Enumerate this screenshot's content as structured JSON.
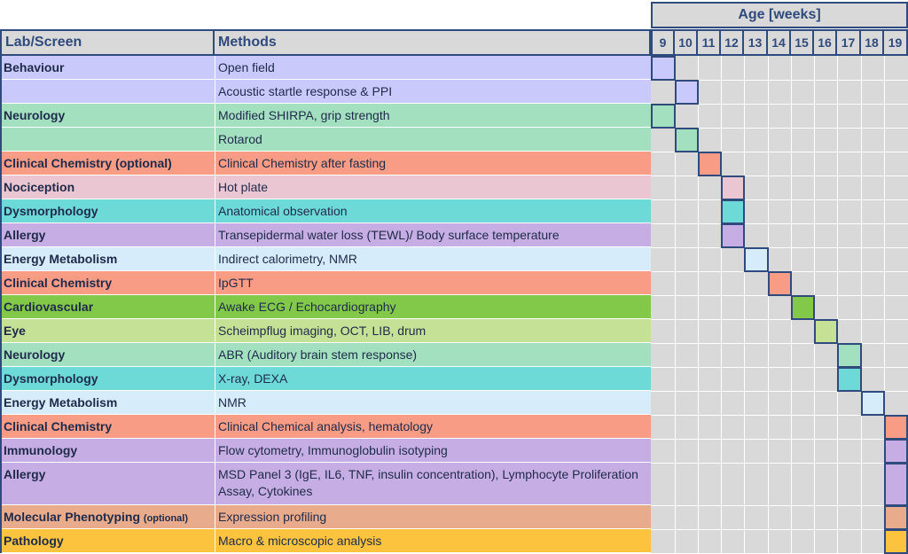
{
  "header": {
    "age_label": "Age [weeks]",
    "lab_label": "Lab/Screen",
    "methods_label": "Methods",
    "weeks": [
      "9",
      "10",
      "11",
      "12",
      "13",
      "14",
      "15",
      "16",
      "17",
      "18",
      "19"
    ]
  },
  "rows": [
    {
      "lab": "Behaviour",
      "method": "Open field",
      "color": "#c9c9fb",
      "week": "9"
    },
    {
      "lab": "",
      "method": "Acoustic startle response & PPI",
      "color": "#c9c9fb",
      "week": "10"
    },
    {
      "lab": "Neurology",
      "method": "Modified SHIRPA, grip strength",
      "color": "#a3e0c0",
      "week": "9"
    },
    {
      "lab": "",
      "method": "Rotarod",
      "color": "#a3e0c0",
      "week": "10"
    },
    {
      "lab": "Clinical Chemistry (optional)",
      "method": "Clinical Chemistry after fasting",
      "color": "#f89c85",
      "week": "11"
    },
    {
      "lab": "Nociception",
      "method": "Hot plate",
      "color": "#eac6d2",
      "week": "12"
    },
    {
      "lab": "Dysmorphology",
      "method": "Anatomical observation",
      "color": "#6ddad8",
      "week": "12"
    },
    {
      "lab": "Allergy",
      "method": "Transepidermal water loss (TEWL)/ Body surface temperature",
      "color": "#c6aee4",
      "week": "12"
    },
    {
      "lab": "Energy Metabolism",
      "method": "Indirect calorimetry, NMR",
      "color": "#d6ecfa",
      "week": "13"
    },
    {
      "lab": "Clinical Chemistry",
      "method": "IpGTT",
      "color": "#f89c85",
      "week": "14"
    },
    {
      "lab": "Cardiovascular",
      "method": "Awake ECG / Echocardiography",
      "color": "#82c94a",
      "week": "15"
    },
    {
      "lab": "Eye",
      "method": "Scheimpflug imaging, OCT, LIB, drum",
      "color": "#c5e196",
      "week": "16"
    },
    {
      "lab": "Neurology",
      "method": "ABR (Auditory brain stem response)",
      "color": "#a3e0c0",
      "week": "17"
    },
    {
      "lab": "Dysmorphology",
      "method": "X-ray, DEXA",
      "color": "#6ddad8",
      "week": "17"
    },
    {
      "lab": "Energy Metabolism",
      "method": "NMR",
      "color": "#d6ecfa",
      "week": "18"
    },
    {
      "lab": "Clinical Chemistry",
      "method": "Clinical Chemical analysis, hematology",
      "color": "#f89c85",
      "week": "19"
    },
    {
      "lab": "Immunology",
      "method": "Flow cytometry, Immunoglobulin isotyping",
      "color": "#c6aee4",
      "week": "19"
    },
    {
      "lab": "Allergy",
      "method": "MSD Panel 3 (IgE, IL6, TNF, insulin concentration), Lymphocyte Proliferation Assay, Cytokines",
      "color": "#c6aee4",
      "week": "19"
    },
    {
      "lab": "Molecular Phenotyping",
      "lab_suffix": "(optional)",
      "method": "Expression profiling",
      "color": "#e8ab8c",
      "week": "19"
    },
    {
      "lab": "Pathology",
      "method": "Macro & microscopic analysis",
      "color": "#fcc43e",
      "week": "19"
    }
  ],
  "border_color": "#2f4a7c",
  "grid_color": "#d9d9d9"
}
